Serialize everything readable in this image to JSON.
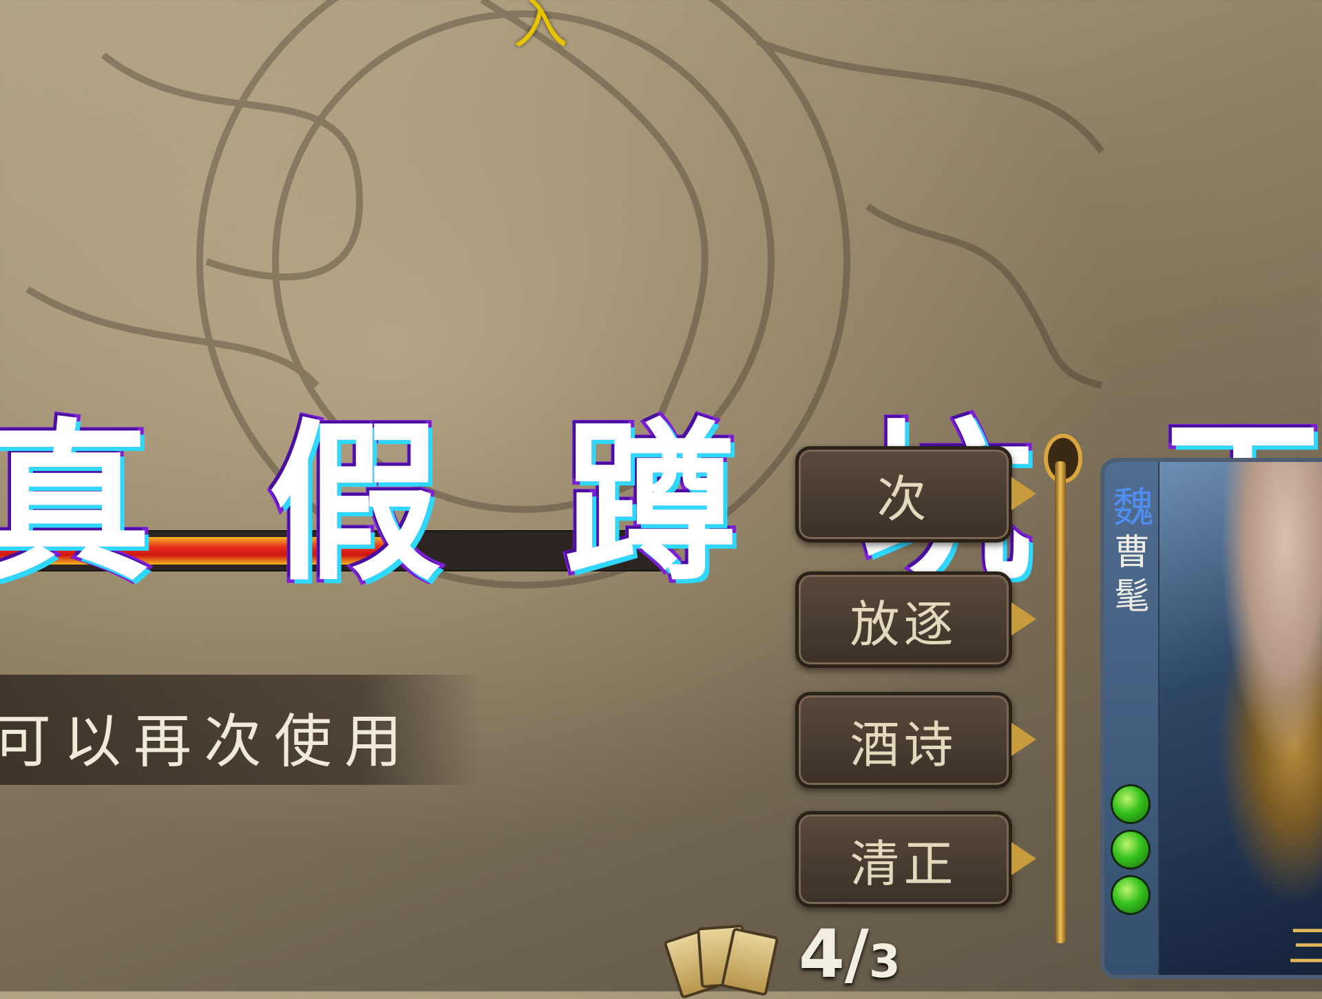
{
  "top_indicator": "入",
  "hint": {
    "text": "可以再次使用"
  },
  "health_bar": {
    "fraction": 0.62
  },
  "title_overlay": {
    "chars": [
      "真",
      "假",
      "蹲",
      "坑",
      "王"
    ]
  },
  "skills": [
    {
      "label": "",
      "partial_label": "次"
    },
    {
      "label": "放逐"
    },
    {
      "label": "酒诗"
    },
    {
      "label": "清正"
    }
  ],
  "general": {
    "kingdom": "魏",
    "name": "曹髦",
    "hp_current": 3,
    "corner_glyph": "三"
  },
  "hand": {
    "count": "4",
    "separator": "/",
    "limit": "3"
  },
  "colors": {
    "title_fill": "#ffffff",
    "title_stroke": "#7b1fd6",
    "title_glow": "#2fd8ff",
    "kingdom_wei": "#4f8df0",
    "hp_green": "#36c21d"
  },
  "icons": [
    "sword-ornament-icon",
    "hand-cards-icon",
    "hp-magatama-icon"
  ]
}
